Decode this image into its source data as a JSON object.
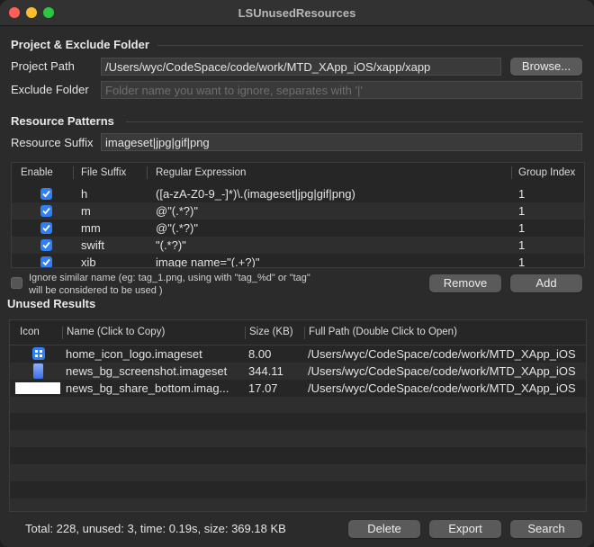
{
  "window": {
    "title": "LSUnusedResources"
  },
  "project": {
    "section_title": "Project & Exclude Folder",
    "path_label": "Project Path",
    "path_value": "/Users/wyc/CodeSpace/code/work/MTD_XApp_iOS/xapp/xapp",
    "browse_label": "Browse...",
    "exclude_label": "Exclude Folder",
    "exclude_placeholder": "Folder name you want to ignore, separates with '|'"
  },
  "patterns": {
    "section_title": "Resource Patterns",
    "suffix_label": "Resource Suffix",
    "suffix_value": "imageset|jpg|gif|png",
    "columns": [
      "Enable",
      "File Suffix",
      "Regular Expression",
      "Group Index"
    ],
    "rows": [
      {
        "enabled": true,
        "suffix": "h",
        "regex": "([a-zA-Z0-9_-]*)\\.(imageset|jpg|gif|png)",
        "group": "1"
      },
      {
        "enabled": true,
        "suffix": "m",
        "regex": "@\"(.*?)\"",
        "group": "1"
      },
      {
        "enabled": true,
        "suffix": "mm",
        "regex": "@\"(.*?)\"",
        "group": "1"
      },
      {
        "enabled": true,
        "suffix": "swift",
        "regex": "\"(.*?)\"",
        "group": "1"
      },
      {
        "enabled": true,
        "suffix": "xib",
        "regex": "image name=\"(.+?)\"",
        "group": "1"
      }
    ],
    "ignore_label_line1": "Ignore similar name (eg: tag_1.png, using with \"tag_%d\" or \"tag\"",
    "ignore_label_line2": "will be considered to be used )",
    "remove_label": "Remove",
    "add_label": "Add"
  },
  "results": {
    "section_title": "Unused Results",
    "columns": [
      "Icon",
      "Name (Click to Copy)",
      "Size (KB)",
      "Full Path (Double Click to Open)"
    ],
    "rows": [
      {
        "icon": "app-grid-icon",
        "name": "home_icon_logo.imageset",
        "size": "8.00",
        "path": "/Users/wyc/CodeSpace/code/work/MTD_XApp_iOS"
      },
      {
        "icon": "phone-screenshot-icon",
        "name": "news_bg_screenshot.imageset",
        "size": "344.11",
        "path": "/Users/wyc/CodeSpace/code/work/MTD_XApp_iOS"
      },
      {
        "icon": "white-banner-icon",
        "name": "news_bg_share_bottom.imag...",
        "size": "17.07",
        "path": "/Users/wyc/CodeSpace/code/work/MTD_XApp_iOS"
      }
    ]
  },
  "status": {
    "summary": "Total: 228, unused: 3, time: 0.19s, size: 369.18 KB",
    "delete_label": "Delete",
    "export_label": "Export",
    "search_label": "Search"
  },
  "colors": {
    "accent": "#2f7ff7",
    "window_bg": "#2b2b2b",
    "button": "#5a5a5a"
  }
}
